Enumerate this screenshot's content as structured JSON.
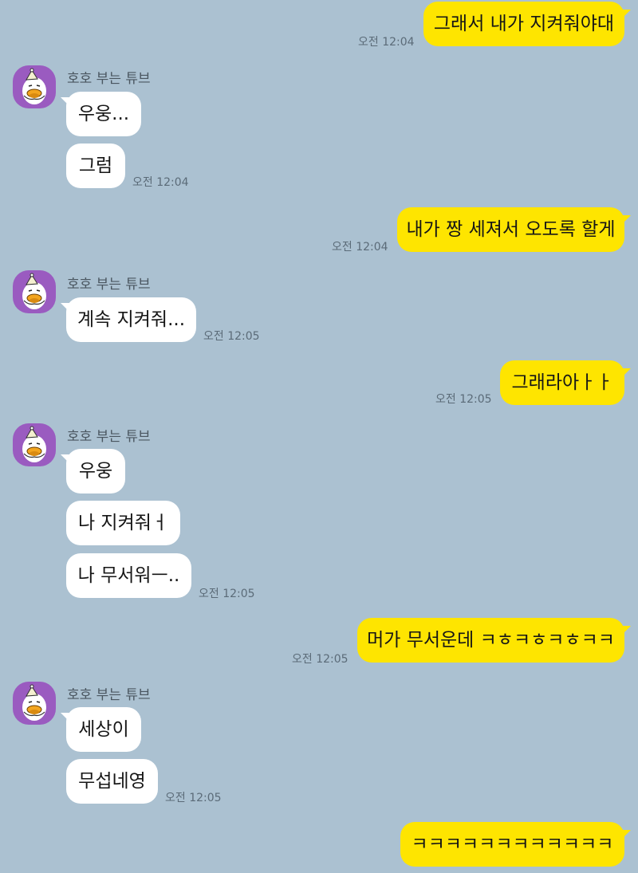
{
  "contact": {
    "name": "호호 부는 튜브"
  },
  "messages": {
    "m1": {
      "text": "그래서 내가 지켜줘야대",
      "time": "오전 12:04"
    },
    "m2": {
      "text": "우웅..."
    },
    "m3": {
      "text": "그럼",
      "time": "오전 12:04"
    },
    "m4": {
      "text": "내가 짱 세져서 오도록 할게",
      "time": "오전 12:04"
    },
    "m5": {
      "text": "계속 지켜줘...",
      "time": "오전 12:05"
    },
    "m6": {
      "text": "그래라아ㅏㅏ",
      "time": "오전 12:05"
    },
    "m7": {
      "text": "우웅"
    },
    "m8": {
      "text": "나 지켜줘ㅓ"
    },
    "m9": {
      "text": "나 무서워ㅡ..",
      "time": "오전 12:05"
    },
    "m10": {
      "text": "머가 무서운데 ㅋㅎㅋㅎㅋㅎㅋㅋ",
      "time": "오전 12:05"
    },
    "m11": {
      "text": "세상이"
    },
    "m12": {
      "text": "무섭네영",
      "time": "오전 12:05"
    },
    "m13": {
      "text": "ㅋㅋㅋㅋㅋㅋㅋㅋㅋㅋㅋㅋ"
    }
  },
  "colors": {
    "background": "#abc1d1",
    "sent_bubble": "#fee500",
    "received_bubble": "#ffffff",
    "avatar_bg": "#9a5bc0"
  },
  "icons": {
    "avatar": "tube-duck-character-icon"
  }
}
